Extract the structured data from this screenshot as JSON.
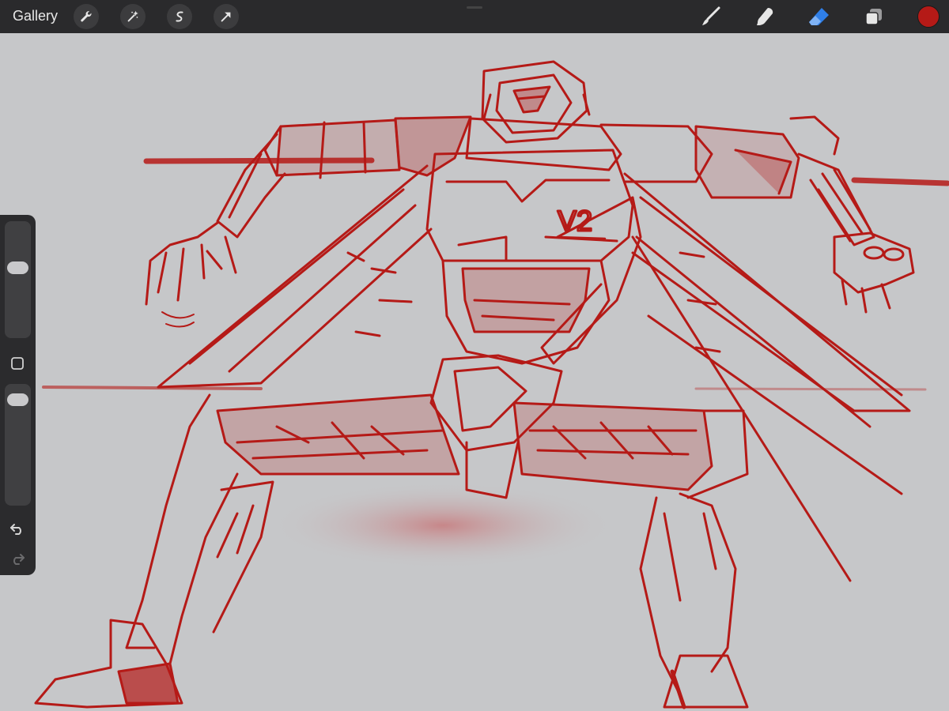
{
  "toolbar": {
    "gallery_label": "Gallery",
    "left_tools": [
      "wrench-icon",
      "magic-wand-icon",
      "selection-icon",
      "transform-arrow-icon"
    ],
    "right_tools": [
      "brush-icon",
      "smudge-icon",
      "eraser-icon",
      "layers-icon"
    ],
    "active_tool": "eraser",
    "current_color": "#b51a17"
  },
  "sidebar": {
    "brush_size_level": 0.62,
    "opacity_level": 0.93
  },
  "artwork": {
    "chest_label": "V2",
    "stroke_color": "#b51a17"
  }
}
